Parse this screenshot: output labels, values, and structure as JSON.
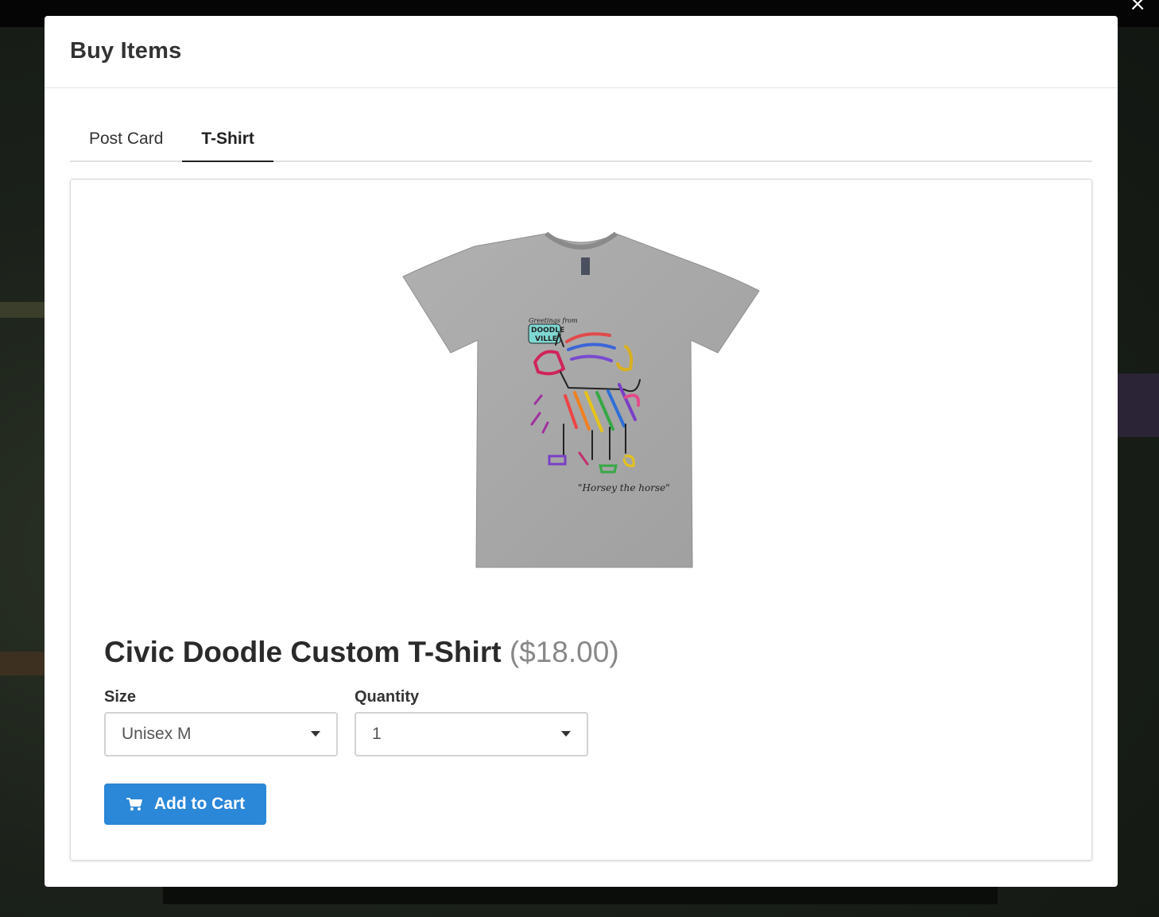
{
  "modal": {
    "title": "Buy Items",
    "close_glyph": "×"
  },
  "tabs": [
    {
      "label": "Post Card",
      "active": false
    },
    {
      "label": "T-Shirt",
      "active": true
    }
  ],
  "product": {
    "image_icon": "tshirt-icon",
    "shirt_color": "#a9a9a9",
    "print_caption": "\"Horsey the horse\"",
    "print_logo_lines": [
      "Greetings from",
      "DOODLE",
      "VILLE"
    ],
    "name": "Civic Doodle Custom T-Shirt",
    "price": "($18.00)"
  },
  "size": {
    "label": "Size",
    "value": "Unisex M"
  },
  "quantity": {
    "label": "Quantity",
    "value": "1"
  },
  "add_to_cart": {
    "label": "Add to Cart",
    "icon": "cart-icon",
    "color": "#2b87d8"
  }
}
